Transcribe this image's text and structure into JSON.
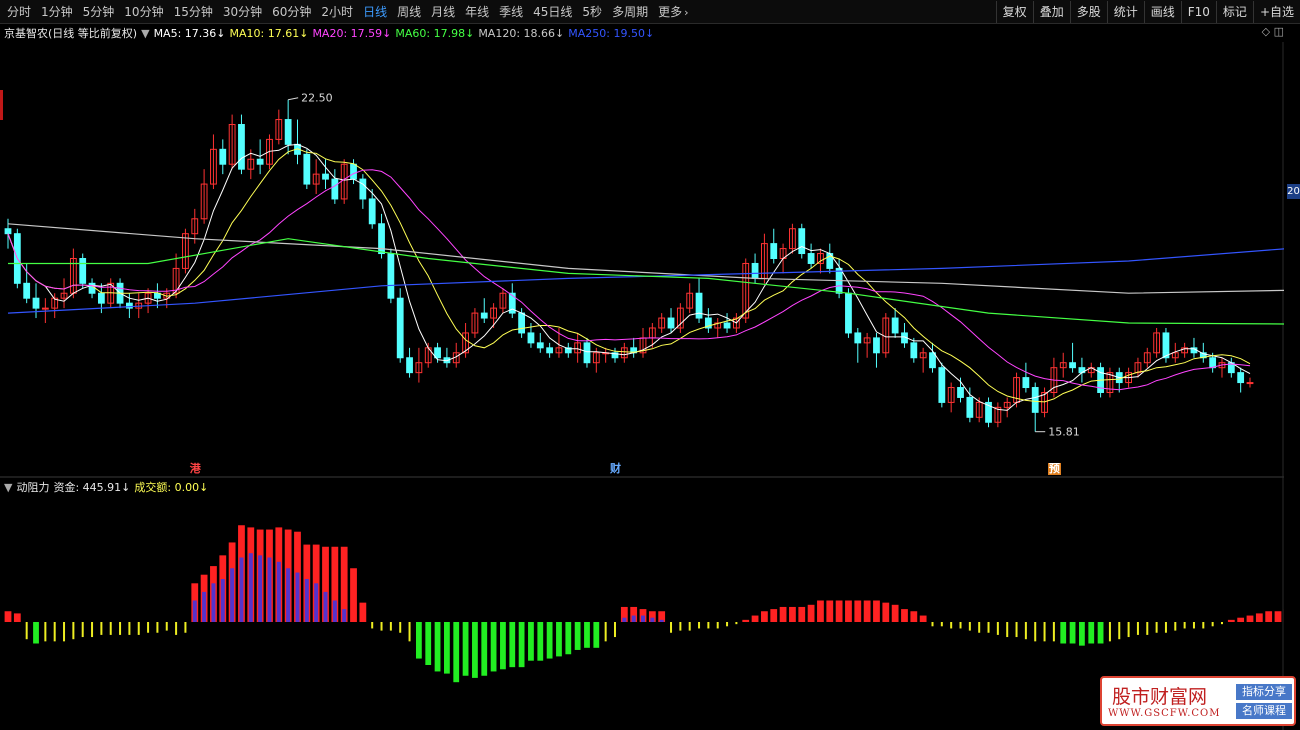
{
  "toolbar": {
    "tabs": [
      "分时",
      "1分钟",
      "5分钟",
      "10分钟",
      "15分钟",
      "30分钟",
      "60分钟",
      "2小时",
      "日线",
      "周线",
      "月线",
      "年线",
      "季线",
      "45日线",
      "5秒",
      "多周期",
      "更多"
    ],
    "active_tab": "日线",
    "right_tools": [
      "复权",
      "叠加",
      "多股",
      "统计",
      "画线",
      "F10",
      "标记",
      "+自选"
    ]
  },
  "legend": {
    "stock": "京基智农(日线 等比前复权)",
    "items": [
      {
        "text": "MA5: 17.36",
        "color": "#ffffff"
      },
      {
        "text": "MA10: 17.61",
        "color": "#ffff55"
      },
      {
        "text": "MA20: 17.59",
        "color": "#ff44ff"
      },
      {
        "text": "MA60: 17.98",
        "color": "#44ff44"
      },
      {
        "text": "MA120: 18.66",
        "color": "#c8c8c8"
      },
      {
        "text": "MA250: 19.50",
        "color": "#3355ff"
      }
    ],
    "arrow": "↓"
  },
  "indicator_legend": {
    "name": "动阻力",
    "items": [
      {
        "text": "资金: 445.91",
        "color": "#e8e8e8"
      },
      {
        "text": "成交额: 0.00",
        "color": "#ffff55"
      }
    ]
  },
  "annotations": {
    "high": "22.50",
    "low": "15.81",
    "right_price": "20"
  },
  "markers": [
    {
      "text": "港",
      "bg": "#000000",
      "color": "#ff4444"
    },
    {
      "text": "财",
      "bg": "#000000",
      "color": "#66aaff"
    },
    {
      "text": "预",
      "bg": "#e08020",
      "color": "#ffffff"
    }
  ],
  "icons": {
    "collapse": "circle-chevron-icon",
    "window": "diamond-icon"
  },
  "watermark": {
    "title": "股市财富网",
    "url": "WWW.GSCFW.COM",
    "tag1": "指标分享",
    "tag2": "名师课程"
  },
  "colors": {
    "up": "#ff3333",
    "down": "#54ffff",
    "active_tab": "#3d9cff"
  },
  "chart_data": {
    "type": "candlestick",
    "price_range": [
      15.3,
      23.3
    ],
    "ohlc": [
      [
        19.9,
        20.1,
        19.5,
        19.8
      ],
      [
        19.8,
        19.9,
        18.7,
        18.8
      ],
      [
        18.8,
        19.2,
        18.4,
        18.5
      ],
      [
        18.5,
        18.8,
        18.1,
        18.3
      ],
      [
        18.3,
        18.5,
        18.0,
        18.3
      ],
      [
        18.3,
        18.6,
        18.1,
        18.5
      ],
      [
        18.5,
        18.9,
        18.3,
        18.6
      ],
      [
        18.6,
        19.5,
        18.5,
        19.3
      ],
      [
        19.3,
        19.4,
        18.7,
        18.8
      ],
      [
        18.8,
        18.9,
        18.5,
        18.6
      ],
      [
        18.6,
        18.8,
        18.2,
        18.4
      ],
      [
        18.4,
        18.9,
        18.3,
        18.8
      ],
      [
        18.8,
        18.9,
        18.3,
        18.4
      ],
      [
        18.4,
        18.6,
        18.1,
        18.3
      ],
      [
        18.3,
        18.6,
        18.1,
        18.4
      ],
      [
        18.4,
        18.7,
        18.2,
        18.6
      ],
      [
        18.6,
        18.8,
        18.3,
        18.5
      ],
      [
        18.5,
        18.7,
        18.3,
        18.6
      ],
      [
        18.6,
        19.4,
        18.5,
        19.1
      ],
      [
        19.1,
        19.9,
        19.0,
        19.8
      ],
      [
        19.8,
        20.3,
        19.6,
        20.1
      ],
      [
        20.1,
        21.1,
        20.0,
        20.8
      ],
      [
        20.8,
        21.8,
        20.7,
        21.5
      ],
      [
        21.5,
        21.7,
        21.0,
        21.2
      ],
      [
        21.2,
        22.2,
        21.1,
        22.0
      ],
      [
        22.0,
        22.2,
        21.0,
        21.1
      ],
      [
        21.1,
        21.5,
        20.9,
        21.3
      ],
      [
        21.3,
        21.7,
        21.0,
        21.2
      ],
      [
        21.2,
        21.8,
        21.1,
        21.7
      ],
      [
        21.7,
        22.3,
        21.6,
        22.1
      ],
      [
        22.1,
        22.5,
        21.4,
        21.6
      ],
      [
        21.6,
        22.1,
        21.2,
        21.4
      ],
      [
        21.4,
        21.5,
        20.7,
        20.8
      ],
      [
        20.8,
        21.3,
        20.6,
        21.0
      ],
      [
        21.0,
        21.3,
        20.7,
        20.9
      ],
      [
        20.9,
        21.1,
        20.4,
        20.5
      ],
      [
        20.5,
        21.3,
        20.4,
        21.2
      ],
      [
        21.2,
        21.3,
        20.8,
        20.9
      ],
      [
        20.9,
        21.0,
        20.3,
        20.5
      ],
      [
        20.5,
        20.7,
        19.9,
        20.0
      ],
      [
        20.0,
        20.2,
        19.3,
        19.4
      ],
      [
        19.4,
        19.5,
        18.4,
        18.5
      ],
      [
        18.5,
        18.7,
        17.2,
        17.3
      ],
      [
        17.3,
        17.5,
        16.9,
        17.0
      ],
      [
        17.0,
        17.5,
        16.8,
        17.2
      ],
      [
        17.2,
        17.6,
        17.1,
        17.5
      ],
      [
        17.5,
        17.6,
        17.2,
        17.3
      ],
      [
        17.3,
        17.5,
        17.1,
        17.2
      ],
      [
        17.2,
        17.6,
        17.1,
        17.4
      ],
      [
        17.4,
        18.0,
        17.3,
        17.8
      ],
      [
        17.8,
        18.3,
        17.7,
        18.2
      ],
      [
        18.2,
        18.5,
        18.0,
        18.1
      ],
      [
        18.1,
        18.4,
        17.9,
        18.3
      ],
      [
        18.3,
        18.7,
        18.2,
        18.6
      ],
      [
        18.6,
        18.8,
        18.1,
        18.2
      ],
      [
        18.2,
        18.3,
        17.7,
        17.8
      ],
      [
        17.8,
        18.0,
        17.5,
        17.6
      ],
      [
        17.6,
        17.8,
        17.4,
        17.5
      ],
      [
        17.5,
        17.6,
        17.3,
        17.4
      ],
      [
        17.4,
        17.9,
        17.3,
        17.5
      ],
      [
        17.5,
        17.6,
        17.3,
        17.4
      ],
      [
        17.4,
        17.8,
        17.2,
        17.6
      ],
      [
        17.6,
        17.7,
        17.1,
        17.2
      ],
      [
        17.2,
        17.5,
        17.0,
        17.4
      ],
      [
        17.4,
        17.5,
        17.2,
        17.4
      ],
      [
        17.4,
        17.5,
        17.2,
        17.3
      ],
      [
        17.3,
        17.6,
        17.2,
        17.5
      ],
      [
        17.5,
        17.7,
        17.3,
        17.4
      ],
      [
        17.4,
        17.9,
        17.3,
        17.7
      ],
      [
        17.7,
        18.0,
        17.5,
        17.9
      ],
      [
        17.9,
        18.2,
        17.8,
        18.1
      ],
      [
        18.1,
        18.3,
        17.8,
        17.9
      ],
      [
        17.9,
        18.4,
        17.8,
        18.3
      ],
      [
        18.3,
        18.8,
        18.2,
        18.6
      ],
      [
        18.6,
        18.9,
        18.0,
        18.1
      ],
      [
        18.1,
        18.3,
        17.8,
        17.9
      ],
      [
        17.9,
        18.1,
        17.7,
        18.0
      ],
      [
        18.0,
        18.2,
        17.8,
        17.9
      ],
      [
        17.9,
        18.2,
        17.8,
        18.1
      ],
      [
        18.1,
        19.3,
        18.0,
        19.2
      ],
      [
        19.2,
        19.4,
        18.8,
        18.9
      ],
      [
        18.9,
        19.8,
        18.8,
        19.6
      ],
      [
        19.6,
        19.9,
        19.2,
        19.3
      ],
      [
        19.3,
        19.6,
        19.0,
        19.5
      ],
      [
        19.5,
        20.0,
        19.4,
        19.9
      ],
      [
        19.9,
        20.0,
        19.3,
        19.4
      ],
      [
        19.4,
        19.6,
        19.1,
        19.2
      ],
      [
        19.2,
        19.5,
        19.0,
        19.4
      ],
      [
        19.4,
        19.6,
        19.0,
        19.1
      ],
      [
        19.1,
        19.3,
        18.5,
        18.6
      ],
      [
        18.6,
        18.7,
        17.7,
        17.8
      ],
      [
        17.8,
        17.9,
        17.2,
        17.6
      ],
      [
        17.6,
        17.8,
        17.3,
        17.7
      ],
      [
        17.7,
        17.8,
        17.1,
        17.4
      ],
      [
        17.4,
        18.2,
        17.3,
        18.1
      ],
      [
        18.1,
        18.3,
        17.7,
        17.8
      ],
      [
        17.8,
        18.0,
        17.5,
        17.6
      ],
      [
        17.6,
        17.7,
        17.2,
        17.3
      ],
      [
        17.3,
        17.5,
        17.0,
        17.4
      ],
      [
        17.4,
        17.6,
        17.0,
        17.1
      ],
      [
        17.1,
        17.2,
        16.3,
        16.4
      ],
      [
        16.4,
        16.8,
        16.2,
        16.7
      ],
      [
        16.7,
        16.9,
        16.4,
        16.5
      ],
      [
        16.5,
        16.7,
        16.0,
        16.1
      ],
      [
        16.1,
        16.5,
        16.0,
        16.4
      ],
      [
        16.4,
        16.5,
        15.9,
        16.0
      ],
      [
        16.0,
        16.4,
        15.9,
        16.3
      ],
      [
        16.3,
        16.5,
        16.1,
        16.4
      ],
      [
        16.4,
        17.0,
        16.3,
        16.9
      ],
      [
        16.9,
        17.2,
        16.6,
        16.7
      ],
      [
        16.7,
        16.8,
        15.81,
        16.2
      ],
      [
        16.2,
        16.7,
        16.1,
        16.6
      ],
      [
        16.6,
        17.3,
        16.5,
        17.1
      ],
      [
        17.1,
        17.4,
        16.9,
        17.2
      ],
      [
        17.2,
        17.6,
        17.0,
        17.1
      ],
      [
        17.1,
        17.3,
        16.8,
        17.0
      ],
      [
        17.0,
        17.2,
        16.9,
        17.1
      ],
      [
        17.1,
        17.2,
        16.5,
        16.6
      ],
      [
        16.6,
        17.1,
        16.5,
        17.0
      ],
      [
        17.0,
        17.1,
        16.6,
        16.8
      ],
      [
        16.8,
        17.1,
        16.7,
        17.0
      ],
      [
        17.0,
        17.3,
        16.9,
        17.2
      ],
      [
        17.2,
        17.5,
        17.1,
        17.4
      ],
      [
        17.4,
        17.9,
        17.3,
        17.8
      ],
      [
        17.8,
        17.9,
        17.2,
        17.3
      ],
      [
        17.3,
        17.6,
        17.2,
        17.4
      ],
      [
        17.4,
        17.6,
        17.3,
        17.5
      ],
      [
        17.5,
        17.7,
        17.3,
        17.4
      ],
      [
        17.4,
        17.6,
        17.2,
        17.3
      ],
      [
        17.3,
        17.4,
        17.0,
        17.1
      ],
      [
        17.1,
        17.3,
        16.9,
        17.2
      ],
      [
        17.2,
        17.3,
        16.9,
        17.0
      ],
      [
        17.0,
        17.1,
        16.6,
        16.8
      ],
      [
        16.8,
        16.9,
        16.7,
        16.8
      ]
    ],
    "ma": {
      "MA120": {
        "color": "#c8c8c8",
        "points": [
          [
            0,
            20.0
          ],
          [
            20,
            19.7
          ],
          [
            40,
            19.5
          ],
          [
            60,
            19.1
          ],
          [
            80,
            18.9
          ],
          [
            100,
            18.8
          ],
          [
            120,
            18.6
          ],
          [
            137,
            18.66
          ]
        ]
      },
      "MA250": {
        "color": "#3355ff",
        "points": [
          [
            0,
            18.2
          ],
          [
            20,
            18.4
          ],
          [
            40,
            18.75
          ],
          [
            60,
            18.9
          ],
          [
            80,
            19.0
          ],
          [
            100,
            19.1
          ],
          [
            120,
            19.25
          ],
          [
            137,
            19.5
          ]
        ]
      },
      "MA60": {
        "color": "#44ff44",
        "points": [
          [
            0,
            19.2
          ],
          [
            15,
            19.2
          ],
          [
            30,
            19.7
          ],
          [
            45,
            19.3
          ],
          [
            60,
            19.0
          ],
          [
            75,
            18.9
          ],
          [
            90,
            18.6
          ],
          [
            105,
            18.2
          ],
          [
            120,
            18.0
          ],
          [
            137,
            17.98
          ]
        ]
      }
    },
    "volume": [
      {
        "fund": [
          5,
          4,
          -8,
          -10,
          -9,
          -9,
          -9,
          -8,
          -7,
          -7,
          -6,
          -6,
          -6,
          -6,
          -6,
          -5,
          -5,
          -4,
          -6,
          -5,
          18,
          22,
          26,
          31,
          37,
          45,
          44,
          43,
          43,
          44,
          43,
          42,
          36,
          36,
          35,
          35,
          35,
          25,
          9,
          -3,
          -4,
          -4,
          -5,
          -9,
          -17,
          -20,
          -23,
          -24,
          -28,
          -25,
          -26,
          -25,
          -23,
          -22,
          -21,
          -21,
          -18,
          -18,
          -17,
          -16,
          -15,
          -13,
          -12,
          -12,
          -9,
          -7,
          7,
          7,
          6,
          5,
          5,
          -5,
          -4,
          -4,
          -3,
          -3,
          -3,
          -2,
          -1,
          1,
          3,
          5,
          6,
          7,
          7,
          7,
          8,
          10,
          10,
          10,
          10,
          10,
          10,
          10,
          9,
          8,
          6,
          5,
          3,
          -2,
          -2,
          -3,
          -3,
          -4,
          -5,
          -5,
          -6,
          -7,
          -7,
          -8,
          -9,
          -9,
          -9,
          -10,
          -10,
          -11,
          -10,
          -10,
          -9,
          -8,
          -7,
          -6,
          -6,
          -5,
          -5,
          -4,
          -3,
          -3,
          -3,
          -2,
          -1,
          1,
          2,
          3,
          4,
          5,
          5,
          6,
          5,
          4,
          4,
          3
        ],
        "purple": [
          0,
          0,
          0,
          0,
          0,
          0,
          0,
          0,
          0,
          0,
          0,
          0,
          0,
          0,
          0,
          0,
          0,
          0,
          0,
          0,
          10,
          14,
          18,
          20,
          25,
          30,
          32,
          31,
          30,
          28,
          25,
          23,
          20,
          18,
          14,
          10,
          6,
          0,
          0,
          0,
          0,
          0,
          0,
          0,
          0,
          0,
          0,
          0,
          0,
          0,
          0,
          0,
          0,
          0,
          0,
          0,
          0,
          0,
          0,
          0,
          0,
          0,
          0,
          0,
          0,
          0,
          2,
          3,
          3,
          2,
          1,
          0,
          0,
          0,
          0,
          0,
          0,
          0,
          0,
          0,
          0,
          0,
          0,
          0,
          0,
          0,
          0,
          0,
          0,
          0,
          0,
          0,
          0,
          0,
          0,
          0,
          0,
          0,
          0,
          0,
          0,
          0,
          0,
          0,
          0,
          0,
          0,
          0,
          0,
          0,
          0,
          0,
          0,
          0,
          0,
          0,
          0,
          0,
          0,
          0,
          0,
          0,
          0,
          0,
          0,
          0,
          0,
          0,
          0,
          0,
          0,
          0,
          0,
          0,
          0,
          0,
          0,
          0
        ]
      }
    ]
  }
}
